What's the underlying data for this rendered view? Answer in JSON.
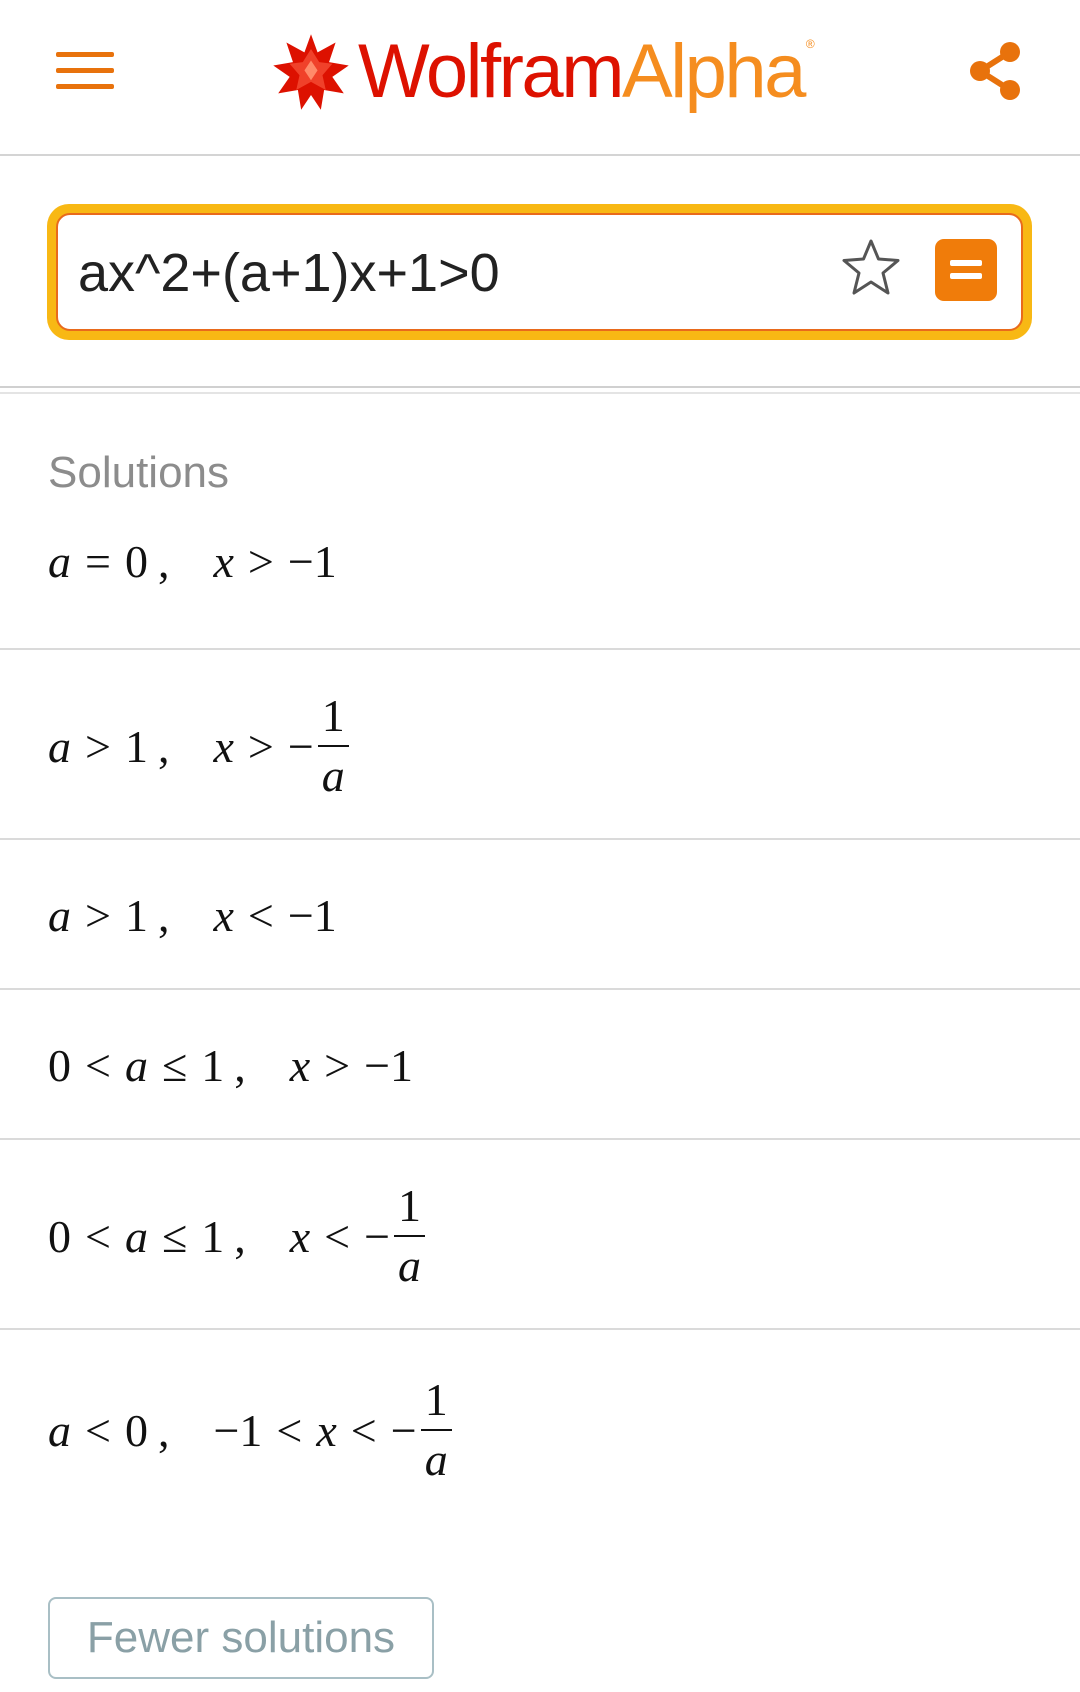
{
  "header": {
    "menu_icon": "hamburger-menu-icon",
    "brand_part1": "Wolfram",
    "brand_part2": "Alpha",
    "brand_mark": "®",
    "share_icon": "share-icon"
  },
  "search": {
    "value": "ax^2+(a+1)x+1>0",
    "star_icon": "star-outline-icon",
    "submit_icon": "equals-icon",
    "accent_color": "#f8b814",
    "border_color": "#e96a1b"
  },
  "results": {
    "pod_title": "Solutions",
    "solutions": [
      {
        "condition": [
          "a",
          "=",
          "0"
        ],
        "relation": [
          "x",
          ">",
          "−1"
        ]
      },
      {
        "condition": [
          "a",
          ">",
          "1"
        ],
        "relation": [
          "x",
          ">",
          "−",
          "1",
          "a"
        ]
      },
      {
        "condition": [
          "a",
          ">",
          "1"
        ],
        "relation": [
          "x",
          "<",
          "−1"
        ]
      },
      {
        "condition": [
          "0",
          "<",
          "a",
          "≤",
          "1"
        ],
        "relation": [
          "x",
          ">",
          "−1"
        ]
      },
      {
        "condition": [
          "0",
          "<",
          "a",
          "≤",
          "1"
        ],
        "relation": [
          "x",
          "<",
          "−",
          "1",
          "a"
        ]
      },
      {
        "condition": [
          "a",
          "<",
          "0"
        ],
        "relation": [
          "−1",
          "<",
          "x",
          "<",
          "−",
          "1",
          "a"
        ]
      }
    ],
    "comma": ",",
    "fewer_button": "Fewer solutions"
  },
  "colors": {
    "brand_red": "#dd1100",
    "brand_orange": "#f58d1f",
    "menu_orange": "#e8720c",
    "button_orange": "#f07c0a"
  }
}
